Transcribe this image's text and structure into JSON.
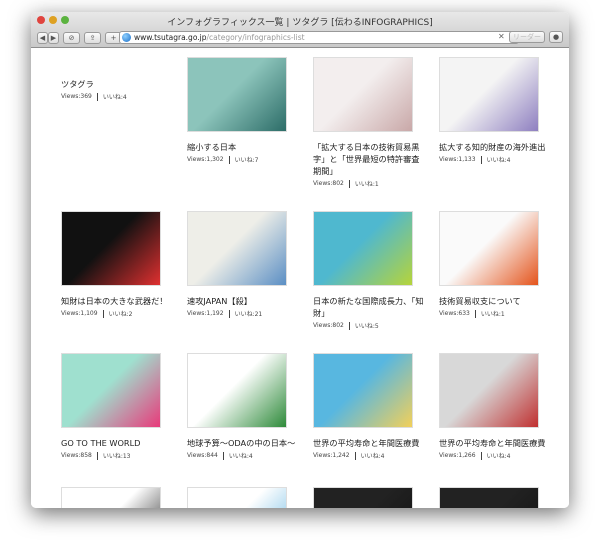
{
  "window": {
    "title": "インフォグラフィックス一覧 | ツタグラ [伝わるINFOGRAPHICS]",
    "url_domain": "www.tsutagra.go.jp",
    "url_path": "/category/infographics-list",
    "reader_label": "リーダー",
    "close_label": "✕"
  },
  "items": [
    {
      "title": "ツタグラ",
      "views": "Views:369",
      "likes": "いいね:4",
      "colors": [
        "#fff",
        "#fff"
      ]
    },
    {
      "title": "縮小する日本",
      "views": "Views:1,302",
      "likes": "いいね:7",
      "colors": [
        "#8cc4bb",
        "#2d6d68"
      ]
    },
    {
      "title": "「拡大する日本の技術貿易黒字」と「世界最短の特許審査期間」",
      "views": "Views:802",
      "likes": "いいね:1",
      "colors": [
        "#f3eeee",
        "#c9a8a8"
      ]
    },
    {
      "title": "拡大する知的財産の海外進出",
      "views": "Views:1,133",
      "likes": "いいね:4",
      "colors": [
        "#f4f4f4",
        "#8e7fc0"
      ]
    },
    {
      "title": "知財は日本の大きな武器だ！",
      "views": "Views:1,109",
      "likes": "いいね:2",
      "colors": [
        "#111",
        "#e03030"
      ]
    },
    {
      "title": "速攻JAPAN【殺】",
      "views": "Views:1,192",
      "likes": "いいね:21",
      "colors": [
        "#eeeee8",
        "#5b8fc4"
      ]
    },
    {
      "title": "日本の新たな国際成長力、「知財」",
      "views": "Views:802",
      "likes": "いいね:5",
      "colors": [
        "#4fb8cf",
        "#b6d43a"
      ]
    },
    {
      "title": "技術貿易収支について",
      "views": "Views:633",
      "likes": "いいね:1",
      "colors": [
        "#fafafa",
        "#e4541c"
      ]
    },
    {
      "title": "GO TO THE WORLD",
      "views": "Views:858",
      "likes": "いいね:13",
      "colors": [
        "#9fe0cf",
        "#e83a7a"
      ]
    },
    {
      "title": "地球予算〜ODAの中の日本〜",
      "views": "Views:844",
      "likes": "いいね:4",
      "colors": [
        "#fff",
        "#2e8a3a"
      ]
    },
    {
      "title": "世界の平均寿命と年間医療費",
      "views": "Views:1,242",
      "likes": "いいね:4",
      "colors": [
        "#58b7e0",
        "#f2d05a"
      ]
    },
    {
      "title": "世界の平均寿命と年間医療費",
      "views": "Views:1,266",
      "likes": "いいね:4",
      "colors": [
        "#d8d8d8",
        "#c03030"
      ]
    },
    {
      "title": "",
      "views": "",
      "likes": "",
      "colors": [
        "#fff",
        "#111"
      ]
    },
    {
      "title": "",
      "views": "",
      "likes": "",
      "colors": [
        "#fff",
        "#5ab0e0"
      ]
    },
    {
      "title": "",
      "views": "",
      "likes": "",
      "colors": [
        "#222",
        "#111"
      ]
    },
    {
      "title": "",
      "views": "",
      "likes": "",
      "colors": [
        "#222",
        "#111"
      ]
    }
  ]
}
